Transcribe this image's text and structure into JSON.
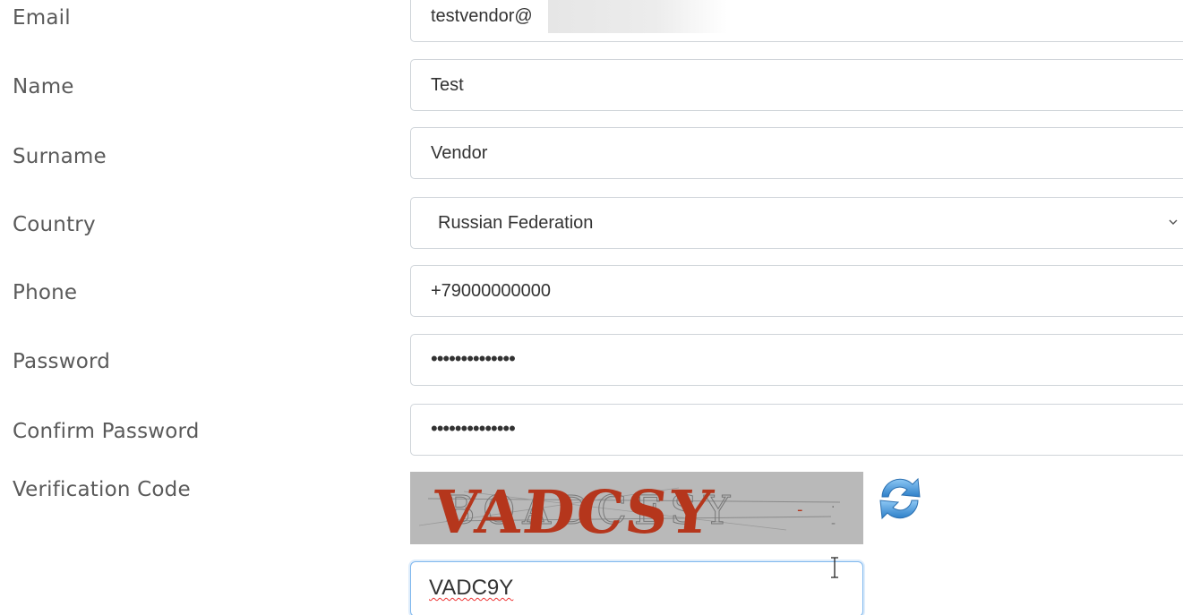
{
  "form": {
    "email": {
      "label": "Email",
      "value": "testvendor@"
    },
    "name": {
      "label": "Name",
      "value": "Test"
    },
    "surname": {
      "label": "Surname",
      "value": "Vendor"
    },
    "country": {
      "label": "Country",
      "value": "Russian Federation"
    },
    "phone": {
      "label": "Phone",
      "value": "+79000000000"
    },
    "password": {
      "label": "Password",
      "value": "••••••••••••••"
    },
    "confirm_password": {
      "label": "Confirm Password",
      "value": "••••••••••••••"
    },
    "verification": {
      "label": "Verification Code",
      "captcha_text": "VADCSY",
      "input_value": "VADC9Y",
      "refresh_icon": "refresh-icon"
    }
  },
  "colors": {
    "label_text": "#5a5a5a",
    "field_border": "#cfd4d9",
    "focus_border": "#80b8ee",
    "captcha_bg": "#b9b9b9",
    "captcha_text": "#b5361c",
    "refresh_blue": "#3a8fd6"
  }
}
